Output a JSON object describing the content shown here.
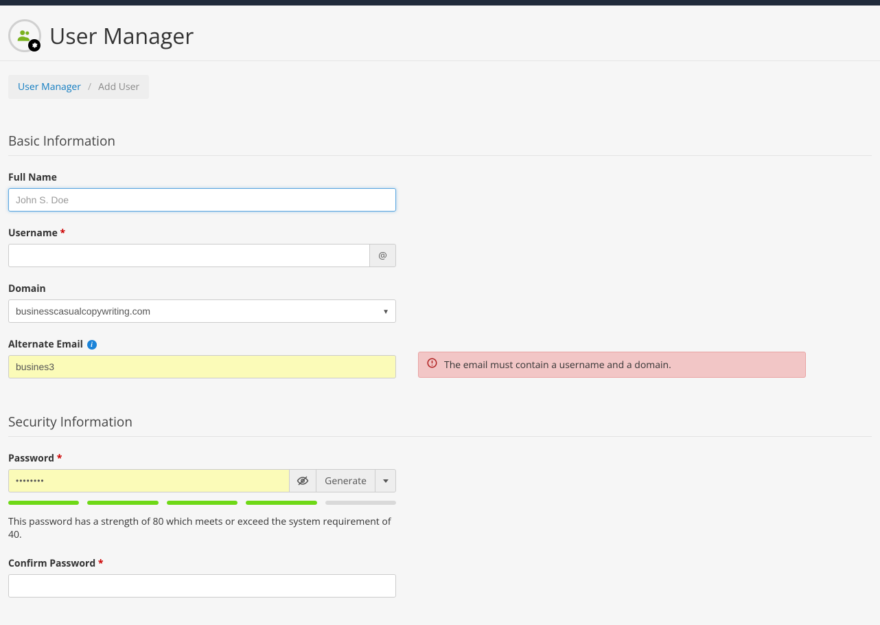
{
  "header": {
    "title": "User Manager"
  },
  "breadcrumb": {
    "parent": "User Manager",
    "current": "Add User"
  },
  "sections": {
    "basic": {
      "title": "Basic Information"
    },
    "security": {
      "title": "Security Information"
    }
  },
  "labels": {
    "full_name": "Full Name",
    "username": "Username",
    "domain": "Domain",
    "alternate_email": "Alternate Email",
    "password": "Password",
    "confirm_password": "Confirm Password",
    "at_symbol": "@",
    "generate": "Generate"
  },
  "fields": {
    "full_name": {
      "placeholder": "John S. Doe",
      "value": ""
    },
    "username": {
      "value": ""
    },
    "domain": {
      "selected": "businesscasualcopywriting.com"
    },
    "alternate_email": {
      "value": "busines3"
    },
    "password": {
      "value_masked": "••••••••"
    },
    "confirm_password": {
      "value": ""
    }
  },
  "validation": {
    "alternate_email_error": "The email must contain a username and a domain."
  },
  "password_strength": {
    "score": 80,
    "requirement": 40,
    "segments_total": 5,
    "segments_on": 4,
    "help_text": "This password has a strength of 80 which meets or exceed the system requirement of 40."
  }
}
